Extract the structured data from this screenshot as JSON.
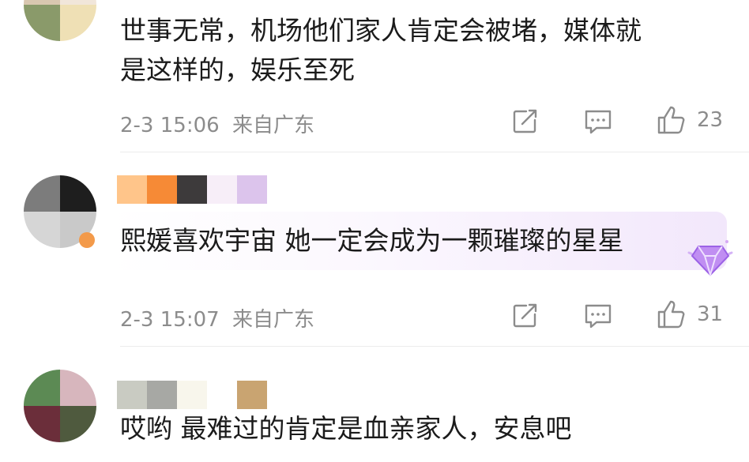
{
  "comments": [
    {
      "text_lines": [
        "世事无常，机场他们家人肯定会被堵，媒体就",
        "是这样的，娱乐至死"
      ],
      "time": "2-3 15:06",
      "location": "来自广东",
      "likes": "23"
    },
    {
      "text_lines": [
        "熙媛喜欢宇宙 她一定会成为一颗璀璨的星星"
      ],
      "time": "2-3 15:07",
      "location": "来自广东",
      "likes": "31"
    },
    {
      "text_lines": [
        "哎哟 最难过的肯定是血亲家人，安息吧"
      ]
    }
  ],
  "icons": {
    "share": "share-icon",
    "comment": "comment-icon",
    "like": "thumbs-up-icon",
    "badge": "diamond-badge-icon"
  },
  "colors": {
    "text": "#1b1b1b",
    "meta": "#8c8c8c",
    "badge": "#b07bf0",
    "bubble_tint": "#f2e7fb"
  }
}
